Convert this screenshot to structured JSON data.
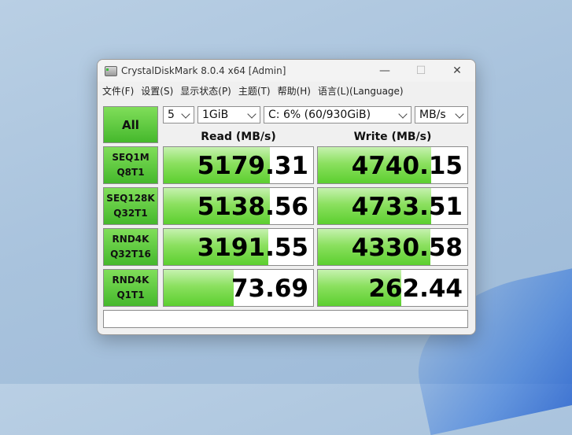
{
  "window": {
    "title": "CrystalDiskMark 8.0.4 x64 [Admin]",
    "controls": {
      "minimize": "—",
      "maximize": "☐",
      "close": "✕"
    }
  },
  "menu": [
    {
      "label": "文件(F)"
    },
    {
      "label": "设置(S)"
    },
    {
      "label": "显示状态(P)"
    },
    {
      "label": "主题(T)"
    },
    {
      "label": "帮助(H)"
    },
    {
      "label": "语言(L)(Language)"
    }
  ],
  "toolbar": {
    "all_label": "All",
    "count_value": "5",
    "size_value": "1GiB",
    "drive_value": "C: 6% (60/930GiB)",
    "unit_value": "MB/s"
  },
  "headers": {
    "read": "Read (MB/s)",
    "write": "Write (MB/s)"
  },
  "rows": [
    {
      "label1": "SEQ1M",
      "label2": "Q8T1",
      "read": "5179.31",
      "write": "4740.15",
      "read_fill": 0.71,
      "write_fill": 0.76
    },
    {
      "label1": "SEQ128K",
      "label2": "Q32T1",
      "read": "5138.56",
      "write": "4733.51",
      "read_fill": 0.71,
      "write_fill": 0.76
    },
    {
      "label1": "RND4K",
      "label2": "Q32T16",
      "read": "3191.55",
      "write": "4330.58",
      "read_fill": 0.7,
      "write_fill": 0.75
    },
    {
      "label1": "RND4K",
      "label2": "Q1T1",
      "read": "73.69",
      "write": "262.44",
      "read_fill": 0.47,
      "write_fill": 0.56
    }
  ],
  "status_text": ""
}
